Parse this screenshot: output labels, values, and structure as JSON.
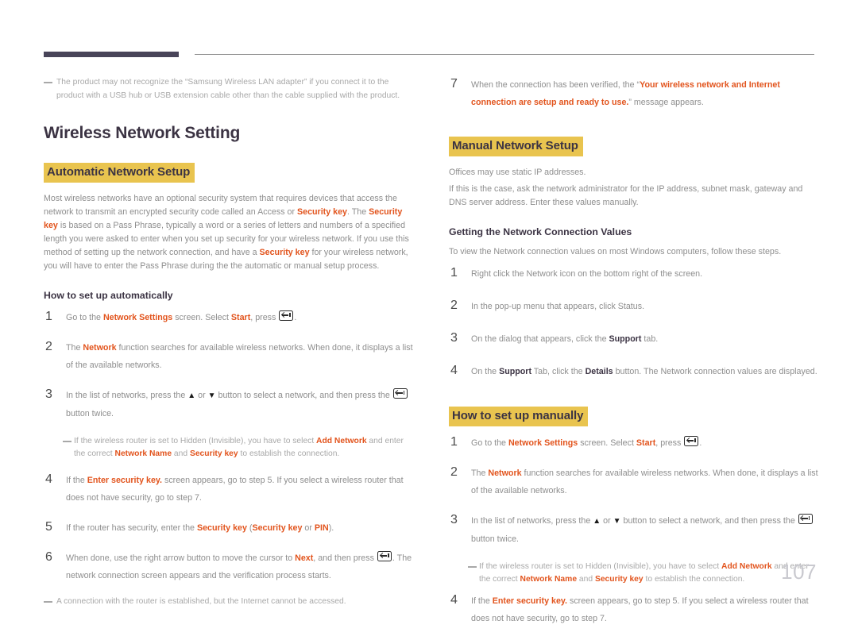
{
  "document": {
    "page_number": "107",
    "accent_color": "#e2541d",
    "highlight_color": "#e9c44f",
    "heading_color": "#3b3343",
    "body_color": "#8e8e8e"
  },
  "left_column": {
    "top_note": "The product may not recognize the “Samsung Wireless LAN adapter” if you connect it to the product with a USB hub or USB extension cable other than the cable supplied with the product.",
    "title": "Wireless Network Setting",
    "section_heading": "Automatic Network Setup",
    "intro_paragraph": {
      "p1": "Most wireless networks have an optional security system that requires devices that access the network to transmit an encrypted security code called an Access or ",
      "k1": "Security key",
      "p2": ". The ",
      "k2": "Security key",
      "p3": " is based on a Pass Phrase, typically a word or a series of letters and numbers of a specified length you were asked to enter when you set up security for your wireless network. If you use this method of setting up the network connection, and have a ",
      "k3": "Security key",
      "p4": " for your wireless network, you will have to enter the Pass Phrase during the the automatic or manual setup process."
    },
    "sub_heading": "How to set up automatically",
    "steps": {
      "s1": {
        "num": "1",
        "p1": "Go to the ",
        "k1": "Network Settings",
        "p2": " screen. Select ",
        "k2": "Start",
        "p3": ", press ",
        "p4": "."
      },
      "s2": {
        "num": "2",
        "p1": "The ",
        "k1": "Network",
        "p2": " function searches for available wireless networks. When done, it displays a list of the available networks."
      },
      "s3": {
        "num": "3",
        "p1": "In the list of networks, press the ",
        "up": "▲",
        "p2": " or ",
        "down": "▼",
        "p3": " button to select a network, and then press the ",
        "p4": " button twice."
      },
      "s3_note": {
        "p1": "If the wireless router is set to Hidden (Invisible), you have to select ",
        "k1": "Add Network",
        "p2": " and enter the correct ",
        "k2": "Network Name",
        "p3": " and ",
        "k3": "Security key",
        "p4": " to establish the connection."
      },
      "s4": {
        "num": "4",
        "p1": "If the ",
        "k1": "Enter security key.",
        "p2": " screen appears, go to step 5. If you select a wireless router that does not have security, go to step 7."
      },
      "s5": {
        "num": "5",
        "p1": "If the router has security, enter the ",
        "k1": "Security key",
        "p2": " (",
        "k2": "Security key",
        "p3": " or ",
        "k3": "PIN",
        "p4": ")."
      },
      "s6": {
        "num": "6",
        "p1": "When done, use the right arrow button to move the cursor to ",
        "k1": "Next",
        "p2": ", and then press ",
        "p3": ". The network connection screen appears and the verification process starts."
      }
    },
    "bottom_note": "A connection with the router is established, but the Internet cannot be accessed."
  },
  "right_column": {
    "step7": {
      "num": "7",
      "p1": "When the connection has been verified, the “",
      "k1": "Your wireless network and Internet connection are setup and ready to use.",
      "p2": "” message appears."
    },
    "section_heading": "Manual Network Setup",
    "para1": "Offices may use static IP addresses.",
    "para2": "If this is the case, ask the network administrator for the IP address, subnet mask, gateway and DNS server address. Enter these values manually.",
    "sub_heading": "Getting the Network Connection Values",
    "sub_intro": "To view the Network connection values on most Windows computers, follow these steps.",
    "values_steps": {
      "s1": {
        "num": "1",
        "text": "Right click the Network icon on the bottom right of the screen."
      },
      "s2": {
        "num": "2",
        "text": "In the pop-up menu that appears, click Status."
      },
      "s3": {
        "num": "3",
        "p1": "On the dialog that appears, click the ",
        "k1": "Support",
        "p2": " tab."
      },
      "s4": {
        "num": "4",
        "p1": "On the ",
        "k1": "Support",
        "p2": " Tab, click the ",
        "k2": "Details",
        "p3": " button. The Network connection values are displayed."
      }
    },
    "manual_heading": "How to set up manually",
    "manual_steps": {
      "s1": {
        "num": "1",
        "p1": "Go to the ",
        "k1": "Network Settings",
        "p2": " screen. Select ",
        "k2": "Start",
        "p3": ", press ",
        "p4": "."
      },
      "s2": {
        "num": "2",
        "p1": "The ",
        "k1": "Network",
        "p2": " function searches for available wireless networks. When done, it displays a list of the available networks."
      },
      "s3": {
        "num": "3",
        "p1": "In the list of networks, press the ",
        "up": "▲",
        "p2": " or ",
        "down": "▼",
        "p3": " button to select a network, and then press the ",
        "p4": " button twice."
      },
      "s3_note": {
        "p1": "If the wireless router is set to Hidden (Invisible), you have to select ",
        "k1": "Add Network",
        "p2": " and enter the correct ",
        "k2": "Network Name",
        "p3": " and ",
        "k3": "Security key",
        "p4": " to establish the connection."
      },
      "s4": {
        "num": "4",
        "p1": "If the ",
        "k1": "Enter security key.",
        "p2": " screen appears, go to step 5. If you select a wireless router that does not have security, go to step 7."
      }
    }
  }
}
